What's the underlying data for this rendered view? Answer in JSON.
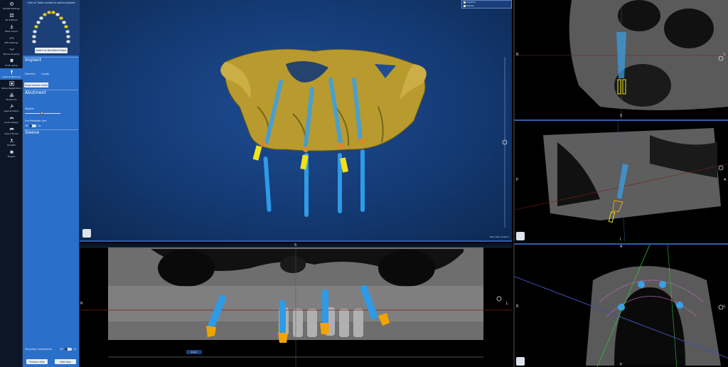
{
  "toolbar": {
    "items": [
      {
        "label": "DICOM Settings",
        "icon": "gear-icon"
      },
      {
        "label": "3D Settings",
        "icon": "cube-icon"
      },
      {
        "label": "Data Import",
        "icon": "import-icon"
      },
      {
        "label": "OPG Settings",
        "icon": "panorama-icon"
      },
      {
        "label": "Nerve Drawing",
        "icon": "nerve-icon"
      },
      {
        "label": "Tooth Setup",
        "icon": "tooth-icon"
      },
      {
        "label": "Implant Planning",
        "icon": "implant-icon",
        "active": true
      },
      {
        "label": "Model Registration",
        "icon": "registration-icon"
      },
      {
        "label": "Model Cut",
        "icon": "scissors-icon"
      },
      {
        "label": "Segmentation",
        "icon": "wrench-icon"
      },
      {
        "label": "Guide Design",
        "icon": "guide-icon"
      },
      {
        "label": "Check Model",
        "icon": "check-icon"
      },
      {
        "label": "SmilWiz",
        "icon": "smile-icon"
      },
      {
        "label": "Plugins",
        "icon": "puzzle-icon"
      }
    ]
  },
  "panel": {
    "chart_hint": "Click on Tooth number to add an Implant",
    "switch_button": "Switch to Mandible Project",
    "implant": {
      "title": "Implant",
      "diameter_label": "Diameter",
      "length_label": "Length",
      "show_button": "Show implant model"
    },
    "abutment": {
      "title": "Abutment",
      "rotation_label": "Rotation",
      "prosthetic_label": "Use Prosthetic Axis",
      "toggle_off": "Off",
      "toggle_on": "On"
    },
    "sleeve": {
      "title": "Sleeve"
    },
    "secondary": {
      "label": "Secondary Components",
      "toggle_off": "Off",
      "toggle_on": "On"
    },
    "prev_button": "Previous step",
    "next_button": "Next step"
  },
  "view3d": {
    "legend": [
      "Implants",
      "Maxilla"
    ],
    "brand": "Blue Skin Anatom"
  },
  "panorama": {
    "left_marker": "R",
    "right_marker": "L",
    "top_marker": "S",
    "zoom_badge": "Zoom"
  },
  "slices": {
    "axial_top": {
      "left_marker": "R",
      "right_marker": "L",
      "bottom_marker": "S"
    },
    "sagittal": {
      "left_marker": "P",
      "right_marker": "A",
      "bottom_marker": "I"
    },
    "axial_bottom": {
      "left_marker": "R",
      "right_marker": "L",
      "top_marker": "A",
      "bottom_marker": "P"
    }
  },
  "colors": {
    "panel": "#2a6fc9",
    "viewport": "#143a74",
    "implant": "#3aa0e8",
    "abutment": "#f0a400",
    "sleeve": "#f2e21b",
    "bone": "#b89a2e"
  }
}
